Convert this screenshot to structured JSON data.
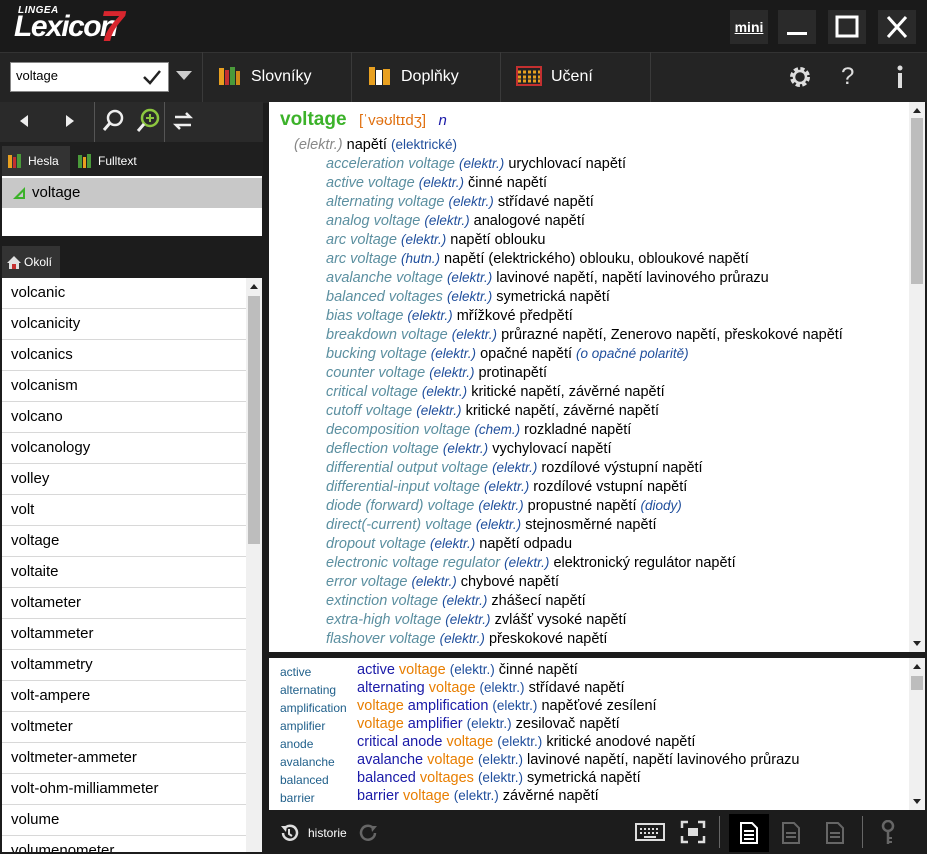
{
  "app": {
    "brand_small": "LINGEA",
    "brand_name": "Lexicon",
    "brand_version": "7"
  },
  "window": {
    "mini_label": "mini"
  },
  "search": {
    "value": "voltage"
  },
  "toolbar": {
    "dictionaries": "Slovníky",
    "addons": "Doplňky",
    "learning": "Učení"
  },
  "tabs": {
    "hesla": "Hesla",
    "fulltext": "Fulltext",
    "okoli": "Okolí"
  },
  "headword_list": {
    "selected": "voltage"
  },
  "wordlist": [
    "volcanic",
    "volcanicity",
    "volcanics",
    "volcanism",
    "volcano",
    "volcanology",
    "volley",
    "volt",
    "voltage",
    "voltaite",
    "voltameter",
    "voltammeter",
    "voltammetry",
    "volt-ampere",
    "voltmeter",
    "voltmeter-ammeter",
    "volt-ohm-milliammeter",
    "volume",
    "volumenometer"
  ],
  "entry": {
    "headword": "voltage",
    "pronunciation": "[ˈvəʊltɪdʒ]",
    "pos": "n",
    "main_label": "(elektr.)",
    "main_translation": "napětí",
    "main_note": "(elektrické)",
    "phrases": [
      {
        "en": "acceleration voltage",
        "label": "(elektr.)",
        "cz": "urychlovací napětí",
        "note": ""
      },
      {
        "en": "active voltage",
        "label": "(elektr.)",
        "cz": "činné napětí",
        "note": ""
      },
      {
        "en": "alternating voltage",
        "label": "(elektr.)",
        "cz": "střídavé napětí",
        "note": ""
      },
      {
        "en": "analog voltage",
        "label": "(elektr.)",
        "cz": "analogové napětí",
        "note": ""
      },
      {
        "en": "arc voltage",
        "label": "(elektr.)",
        "cz": "napětí oblouku",
        "note": ""
      },
      {
        "en": "arc voltage",
        "label": "(hutn.)",
        "cz": "napětí (elektrického) oblouku, obloukové napětí",
        "note": ""
      },
      {
        "en": "avalanche voltage",
        "label": "(elektr.)",
        "cz": "lavinové napětí, napětí lavinového průrazu",
        "note": ""
      },
      {
        "en": "balanced voltages",
        "label": "(elektr.)",
        "cz": "symetrická napětí",
        "note": ""
      },
      {
        "en": "bias voltage",
        "label": "(elektr.)",
        "cz": "mřížkové předpětí",
        "note": ""
      },
      {
        "en": "breakdown voltage",
        "label": "(elektr.)",
        "cz": "průrazné napětí, Zenerovo napětí, přeskokové napětí",
        "note": ""
      },
      {
        "en": "bucking voltage",
        "label": "(elektr.)",
        "cz": "opačné napětí",
        "note": "(o opačné polaritě)"
      },
      {
        "en": "counter voltage",
        "label": "(elektr.)",
        "cz": "protinapětí",
        "note": ""
      },
      {
        "en": "critical voltage",
        "label": "(elektr.)",
        "cz": "kritické napětí, závěrné napětí",
        "note": ""
      },
      {
        "en": "cutoff voltage",
        "label": "(elektr.)",
        "cz": "kritické napětí, závěrné napětí",
        "note": ""
      },
      {
        "en": "decomposition voltage",
        "label": "(chem.)",
        "cz": "rozkladné napětí",
        "note": ""
      },
      {
        "en": "deflection voltage",
        "label": "(elektr.)",
        "cz": "vychylovací napětí",
        "note": ""
      },
      {
        "en": "differential output voltage",
        "label": "(elektr.)",
        "cz": "rozdílové výstupní napětí",
        "note": ""
      },
      {
        "en": "differential-input voltage",
        "label": "(elektr.)",
        "cz": "rozdílové vstupní napětí",
        "note": ""
      },
      {
        "en": "diode (forward) voltage",
        "label": "(elektr.)",
        "cz": "propustné napětí",
        "note": "(diody)"
      },
      {
        "en": "direct(-current) voltage",
        "label": "(elektr.)",
        "cz": "stejnosměrné napětí",
        "note": ""
      },
      {
        "en": "dropout voltage",
        "label": "(elektr.)",
        "cz": "napětí odpadu",
        "note": ""
      },
      {
        "en": "electronic voltage regulator",
        "label": "(elektr.)",
        "cz": "elektronický regulátor napětí",
        "note": ""
      },
      {
        "en": "error voltage",
        "label": "(elektr.)",
        "cz": "chybové napětí",
        "note": ""
      },
      {
        "en": "extinction voltage",
        "label": "(elektr.)",
        "cz": "zhášecí napětí",
        "note": ""
      },
      {
        "en": "extra-high voltage",
        "label": "(elektr.)",
        "cz": "zvlášť vysoké napětí",
        "note": ""
      },
      {
        "en": "flashover voltage",
        "label": "(elektr.)",
        "cz": "přeskokové napětí",
        "note": ""
      }
    ]
  },
  "fulltext_rows": [
    {
      "key": "active",
      "parts": [
        {
          "t": "active ",
          "c": "blue"
        },
        {
          "t": "voltage",
          "c": "orange"
        }
      ],
      "label": "(elektr.)",
      "cz": "činné napětí"
    },
    {
      "key": "alternating",
      "parts": [
        {
          "t": "alternating ",
          "c": "blue"
        },
        {
          "t": "voltage",
          "c": "orange"
        }
      ],
      "label": "(elektr.)",
      "cz": "střídavé napětí"
    },
    {
      "key": "amplification",
      "parts": [
        {
          "t": "voltage ",
          "c": "orange"
        },
        {
          "t": "amplification",
          "c": "blue"
        }
      ],
      "label": "(elektr.)",
      "cz": "napěťové zesílení"
    },
    {
      "key": "amplifier",
      "parts": [
        {
          "t": "voltage ",
          "c": "orange"
        },
        {
          "t": "amplifier",
          "c": "blue"
        }
      ],
      "label": "(elektr.)",
      "cz": "zesilovač napětí"
    },
    {
      "key": "anode",
      "parts": [
        {
          "t": "critical anode ",
          "c": "blue"
        },
        {
          "t": "voltage",
          "c": "orange"
        }
      ],
      "label": "(elektr.)",
      "cz": "kritické anodové napětí"
    },
    {
      "key": "avalanche",
      "parts": [
        {
          "t": "avalanche ",
          "c": "blue"
        },
        {
          "t": "voltage",
          "c": "orange"
        }
      ],
      "label": "(elektr.)",
      "cz": "lavinové napětí, napětí lavinového průrazu"
    },
    {
      "key": "balanced",
      "parts": [
        {
          "t": "balanced ",
          "c": "blue"
        },
        {
          "t": "voltages",
          "c": "orange"
        }
      ],
      "label": "(elektr.)",
      "cz": "symetrická napětí"
    },
    {
      "key": "barrier",
      "parts": [
        {
          "t": "barrier ",
          "c": "blue"
        },
        {
          "t": "voltage",
          "c": "orange"
        }
      ],
      "label": "(elektr.)",
      "cz": "závěrné napětí"
    }
  ],
  "bottombar": {
    "history_label": "historie"
  },
  "colors": {
    "headword": "#3cb22a",
    "pron": "#e07010",
    "pos": "#1a1aa8",
    "en_phrase": "#5b8fa0",
    "label": "#1f4e9c",
    "accent_red": "#d8262e"
  },
  "icons": [
    "checkmark-icon",
    "dropdown-icon",
    "books-icon",
    "addons-icon",
    "abacus-icon",
    "gear-icon",
    "help-icon",
    "info-icon",
    "back-icon",
    "forward-icon",
    "search-icon",
    "zoom-search-icon",
    "swap-icon",
    "history-icon",
    "keyboard-icon",
    "fullscreen-icon",
    "document-icon",
    "key-icon"
  ]
}
